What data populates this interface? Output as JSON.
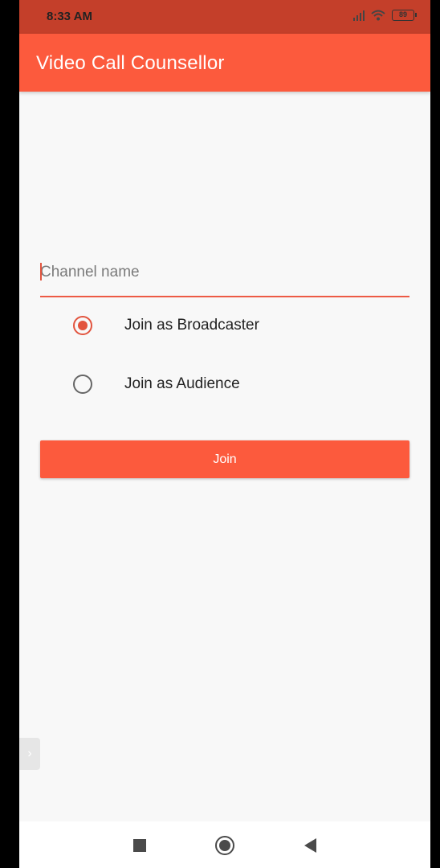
{
  "status_bar": {
    "time": "8:33 AM",
    "battery_level": "89",
    "icons": [
      "signal-icon",
      "wifi-icon",
      "battery-icon"
    ]
  },
  "app_bar": {
    "title": "Video Call Counsellor",
    "color": "#fc5a3d"
  },
  "form": {
    "channel_placeholder": "Channel name",
    "channel_value": "",
    "roles": [
      {
        "label": "Join as Broadcaster",
        "selected": true
      },
      {
        "label": "Join as Audience",
        "selected": false
      }
    ],
    "join_label": "Join"
  },
  "nav_bar": {
    "buttons": [
      "recents-icon",
      "home-icon",
      "back-icon"
    ]
  },
  "colors": {
    "accent": "#e2543e",
    "status_bar": "#c43f2a",
    "background": "#f8f8f8"
  }
}
